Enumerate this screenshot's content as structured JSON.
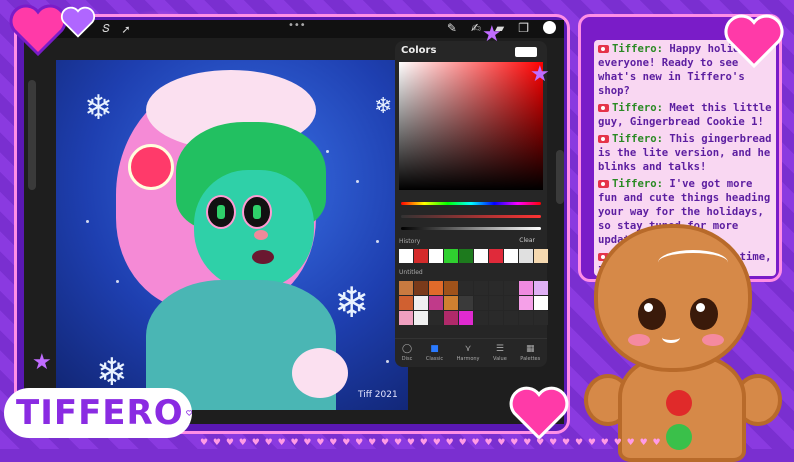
{
  "app": {
    "colors_panel": {
      "title": "Colors",
      "history_label": "History",
      "clear_label": "Clear",
      "palette_label": "Untitled",
      "history_swatches": [
        "#ffffff",
        "#d42b2b",
        "#ffffff",
        "#2fd02f",
        "#1d7a1d",
        "#ffffff",
        "#e02a3a",
        "#ffffff",
        "#e0e0e0",
        "#f5d9b0"
      ],
      "palette_swatches": [
        "#c87a40",
        "#7a3a1a",
        "#e06a2a",
        "#a0521a",
        "#2a2a2a",
        "#2a2a2a",
        "#2a2a2a",
        "#2a2a2a",
        "#f08ae0",
        "#e0b0f5",
        "#d06030",
        "#f0f0f0",
        "#c03a8a",
        "#d08030",
        "#3a3a3a",
        "#2a2a2a",
        "#2a2a2a",
        "#2a2a2a",
        "#f5a0e8",
        "#ffffff",
        "#f0a0c0",
        "#f0f0f0",
        "#2a2a2a",
        "#b02a6a",
        "#e02ad0",
        "#2a2a2a",
        "#2a2a2a",
        "#2a2a2a",
        "#2a2a2a",
        "#2a2a2a"
      ],
      "tabs": [
        {
          "label": "Disc",
          "icon": "disc-icon"
        },
        {
          "label": "Classic",
          "icon": "classic-icon"
        },
        {
          "label": "Harmony",
          "icon": "harmony-icon"
        },
        {
          "label": "Value",
          "icon": "value-icon"
        },
        {
          "label": "Palettes",
          "icon": "palettes-icon"
        }
      ]
    },
    "topbar_dots": "•••",
    "signature": "Tiff 2021"
  },
  "chat": {
    "messages": [
      {
        "name": "Tiffero:",
        "text": "Happy holidays everyone! Ready to see what's new in Tiffero's shop?"
      },
      {
        "name": "Tiffero:",
        "text": "Meet this little guy, Gingerbread Cookie 1!"
      },
      {
        "name": "Tiffero:",
        "text": "This gingerbread is the lite version, and he blinks and talks!"
      },
      {
        "name": "Tiffero:",
        "text": "I've got more fun and cute things heading your way for the holidays, so stay tuned for more updates! 🙂"
      },
      {
        "name": "Tiffero:",
        "text": "In the meantime, I hope you have a happy holidays and"
      }
    ]
  },
  "logo": {
    "text": "TIFFERO"
  },
  "colors": {
    "accent": "#8a2be2",
    "frame": "#ff8ee6",
    "chat_bg": "#f9d7f2",
    "name": "#2a8a24"
  }
}
